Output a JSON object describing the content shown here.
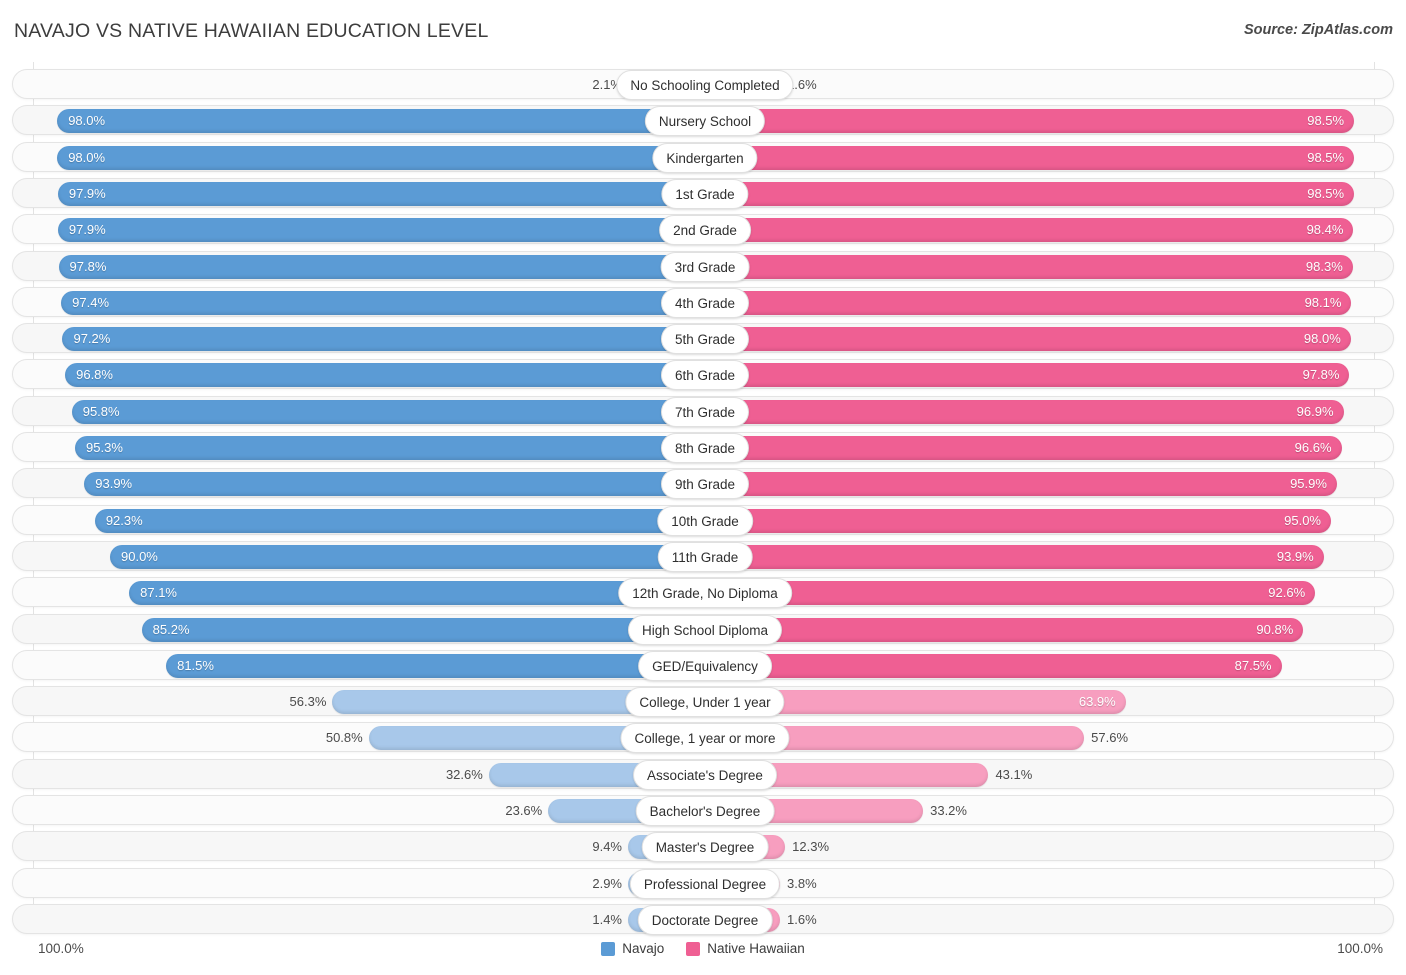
{
  "header": {
    "title": "Navajo vs Native Hawaiian Education Level",
    "source": "Source: ZipAtlas.com"
  },
  "footer": {
    "axis_left": "100.0%",
    "axis_right": "100.0%",
    "legend": [
      {
        "label": "Navajo",
        "color": "#5b9bd5"
      },
      {
        "label": "Native Hawaiian",
        "color": "#ef5f93"
      }
    ]
  },
  "colors": {
    "navajo_strong": "#5b9bd5",
    "navajo_light": "#a8c8ea",
    "hawaiian_strong": "#ef5f93",
    "hawaiian_light": "#f79ebf",
    "track": "#f7f7f7",
    "track_border": "#e4e4e4",
    "gridline": "#e3e3e3"
  },
  "chart_data": {
    "type": "bar",
    "title": "Navajo vs Native Hawaiian Education Level",
    "subtitle": "Source: ZipAtlas.com",
    "orientation": "horizontal-diverging",
    "xlabel": "",
    "ylabel": "",
    "xlim": [
      0,
      100
    ],
    "axis_labels": {
      "left": "100.0%",
      "right": "100.0%"
    },
    "grid": true,
    "legend_position": "bottom-center",
    "categories": [
      "No Schooling Completed",
      "Nursery School",
      "Kindergarten",
      "1st Grade",
      "2nd Grade",
      "3rd Grade",
      "4th Grade",
      "5th Grade",
      "6th Grade",
      "7th Grade",
      "8th Grade",
      "9th Grade",
      "10th Grade",
      "11th Grade",
      "12th Grade, No Diploma",
      "High School Diploma",
      "GED/Equivalency",
      "College, Under 1 year",
      "College, 1 year or more",
      "Associate's Degree",
      "Bachelor's Degree",
      "Master's Degree",
      "Professional Degree",
      "Doctorate Degree"
    ],
    "series": [
      {
        "name": "Navajo",
        "color": "#5b9bd5",
        "values": [
          2.1,
          98.0,
          98.0,
          97.9,
          97.9,
          97.8,
          97.4,
          97.2,
          96.8,
          95.8,
          95.3,
          93.9,
          92.3,
          90.0,
          87.1,
          85.2,
          81.5,
          56.3,
          50.8,
          32.6,
          23.6,
          9.4,
          2.9,
          1.4
        ],
        "labels": [
          "2.1%",
          "98.0%",
          "98.0%",
          "97.9%",
          "97.9%",
          "97.8%",
          "97.4%",
          "97.2%",
          "96.8%",
          "95.8%",
          "95.3%",
          "93.9%",
          "92.3%",
          "90.0%",
          "87.1%",
          "85.2%",
          "81.5%",
          "56.3%",
          "50.8%",
          "32.6%",
          "23.6%",
          "9.4%",
          "2.9%",
          "1.4%"
        ]
      },
      {
        "name": "Native Hawaiian",
        "color": "#ef5f93",
        "values": [
          1.6,
          98.5,
          98.5,
          98.5,
          98.4,
          98.3,
          98.1,
          98.0,
          97.8,
          96.9,
          96.6,
          95.9,
          95.0,
          93.9,
          92.6,
          90.8,
          87.5,
          63.9,
          57.6,
          43.1,
          33.2,
          12.3,
          3.8,
          1.6
        ],
        "labels": [
          "1.6%",
          "98.5%",
          "98.5%",
          "98.5%",
          "98.4%",
          "98.3%",
          "98.1%",
          "98.0%",
          "97.8%",
          "96.9%",
          "96.6%",
          "95.9%",
          "95.0%",
          "93.9%",
          "92.6%",
          "90.8%",
          "87.5%",
          "63.9%",
          "57.6%",
          "43.1%",
          "33.2%",
          "12.3%",
          "3.8%",
          "1.6%"
        ]
      }
    ]
  }
}
